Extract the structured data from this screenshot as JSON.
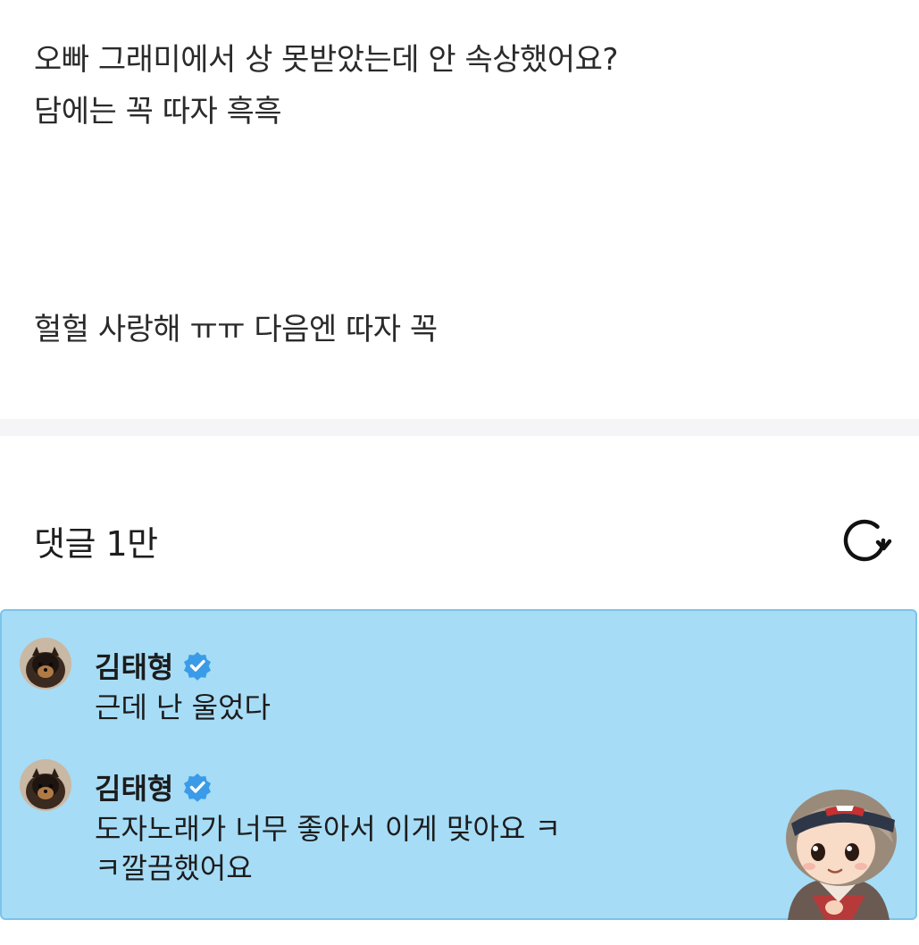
{
  "post": {
    "question_lines": [
      "오빠 그래미에서 상 못받았는데 안 속상했어요?",
      "담에는 꼭 따자 흑흑"
    ],
    "reply": "헐헐 사랑해 ㅠㅠ 다음엔 따자 꼭"
  },
  "comments_section": {
    "header": "댓글 1만",
    "refresh_icon": "refresh-icon"
  },
  "comments": [
    {
      "author": "김태형",
      "verified_icon": "verified-badge-icon",
      "text_lines": [
        "근데 난 울었다"
      ]
    },
    {
      "author": "김태형",
      "verified_icon": "verified-badge-icon",
      "text_lines": [
        "도자노래가 너무 좋아서 이게 맞아요 ㅋ",
        "ㅋ깔끔했어요"
      ]
    }
  ],
  "colors": {
    "highlight_background": "#a6dcf6",
    "highlight_border": "#7cc3e8",
    "verified_blue": "#3a9be8",
    "divider": "#f5f5f8"
  }
}
